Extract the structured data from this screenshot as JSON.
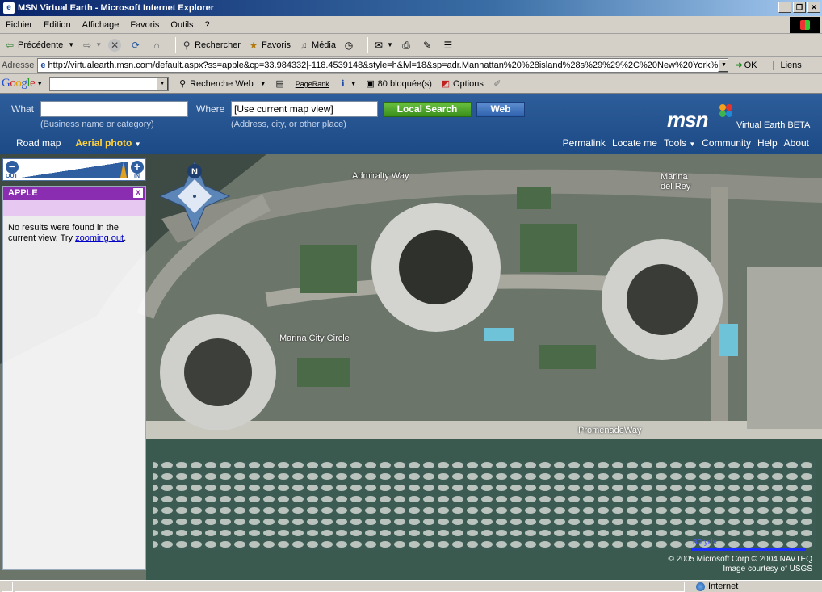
{
  "window": {
    "title": "MSN Virtual Earth - Microsoft Internet Explorer"
  },
  "menu": [
    "Fichier",
    "Edition",
    "Affichage",
    "Favoris",
    "Outils",
    "?"
  ],
  "toolbar": {
    "back": "Précédente",
    "search": "Rechercher",
    "favorites": "Favoris",
    "media": "Média"
  },
  "address": {
    "label": "Adresse",
    "url": "http://virtualearth.msn.com/default.aspx?ss=apple&cp=33.984332|-118.4539148&style=h&lvl=18&sp=adr.Manhattan%20%28island%28s%29%29%2C%20New%20York%",
    "go": "OK",
    "links": "Liens"
  },
  "google": {
    "search_web": "Recherche Web",
    "pagerank": "PageRank",
    "blocked": "80 bloquée(s)",
    "options": "Options"
  },
  "msn": {
    "what_label": "What",
    "what_value": "",
    "what_hint": "(Business name or category)",
    "where_label": "Where",
    "where_value": "[Use current map view]",
    "where_hint": "(Address, city, or other place)",
    "local_search": "Local Search",
    "web": "Web",
    "logo": "msn",
    "product": "Virtual Earth BETA",
    "nav_left": {
      "road": "Road map",
      "aerial": "Aerial photo"
    },
    "nav_right": {
      "permalink": "Permalink",
      "locate": "Locate me",
      "tools": "Tools",
      "community": "Community",
      "help": "Help",
      "about": "About"
    }
  },
  "zoom": {
    "out": "OUT",
    "in": "IN"
  },
  "panel": {
    "title": "APPLE",
    "close": "x",
    "msg_pre": "No results were found in the current view. Try ",
    "msg_link": "zooming out",
    "msg_post": "."
  },
  "compass": {
    "north": "N"
  },
  "map_labels": {
    "admiralty": "Admiralty Way",
    "marina": "Marina del Rey",
    "circle": "Marina City Circle",
    "promenade": "PromenadeWay"
  },
  "scale": {
    "label": "80 yds"
  },
  "copyright": {
    "line1": "© 2005 Microsoft Corp  © 2004 NAVTEQ",
    "line2": "Image courtesy of USGS"
  },
  "status": {
    "zone": "Internet"
  },
  "colors": {
    "header_blue": "#2d5d9a",
    "panel_purple": "#8a2db0",
    "local_green": "#3a8f1c",
    "aerial_active": "#ffd23c"
  }
}
